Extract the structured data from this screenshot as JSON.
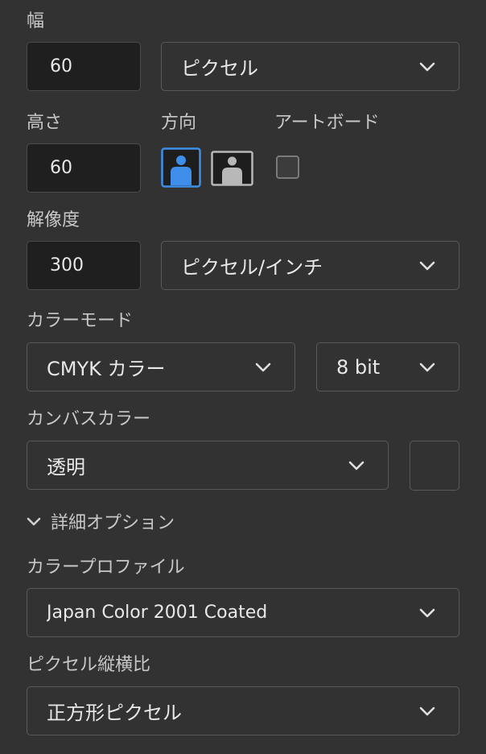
{
  "width": {
    "label": "幅",
    "value": "60",
    "unit": "ピクセル"
  },
  "height": {
    "label": "高さ",
    "value": "60"
  },
  "orientation": {
    "label": "方向"
  },
  "artboard": {
    "label": "アートボード"
  },
  "resolution": {
    "label": "解像度",
    "value": "300",
    "unit": "ピクセル/インチ"
  },
  "color_mode": {
    "label": "カラーモード",
    "mode": "CMYK カラー",
    "bits": "8 bit"
  },
  "canvas_color": {
    "label": "カンバスカラー",
    "value": "透明"
  },
  "advanced": {
    "label": "詳細オプション"
  },
  "color_profile": {
    "label": "カラープロファイル",
    "value": "Japan Color 2001 Coated"
  },
  "pixel_aspect": {
    "label": "ピクセル縦横比",
    "value": "正方形ピクセル"
  },
  "colors": {
    "accent": "#3f8fea",
    "panel": "#323232",
    "input_bg": "#1f1f1f"
  }
}
